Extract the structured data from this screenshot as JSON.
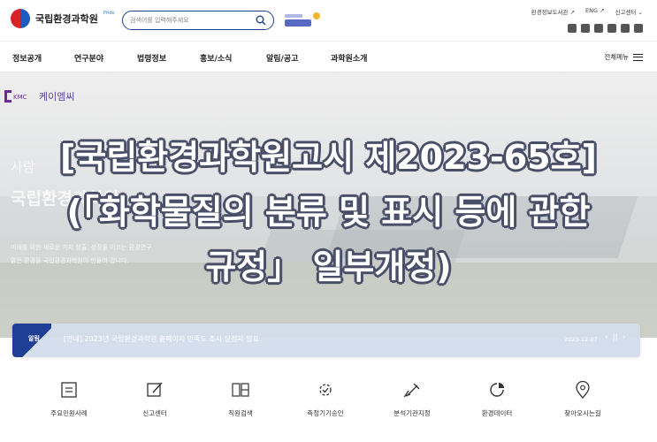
{
  "header": {
    "logo_text": "국립환경과학원",
    "logo_sub": "Pride",
    "search_placeholder": "검색어를 입력해주세요",
    "utility": [
      "환경정보도서관 ↗",
      "ENG ↗",
      "신고센터 ⌄"
    ],
    "social_icons": [
      "facebook-icon",
      "twitter-icon",
      "blog-icon",
      "instagram-icon",
      "kakao-icon",
      "youtube-icon"
    ]
  },
  "nav": {
    "items": [
      "정보공개",
      "연구분야",
      "법령정보",
      "홍보/소식",
      "알림/공고",
      "과학원소개"
    ],
    "all_menu": "전체메뉴"
  },
  "hero": {
    "brand": "케이엠씨",
    "brand_mark": "KMC",
    "subtitle1": "사람",
    "subtitle2": "국립환경과학원",
    "desc1": "미래를 위한 새로운 가치 창출, 성장을 이끄는 환경연구",
    "desc2": "맑은 환경을 국립환경과학원이 만들어 갑니다."
  },
  "overlay": {
    "line1": "[국립환경과학원고시 제2023-65호]",
    "line2": "(「화학물질의 분류 및 표시 등에 관한",
    "line3": "규정」 일부개정)"
  },
  "notice": {
    "label": "알림",
    "text": "[안내] 2023년 국립환경과학원 홈페이지 만족도 조사 당첨자 발표",
    "date": "2023-12-07",
    "controls": [
      "‹",
      "||",
      "›"
    ]
  },
  "quick_menu": [
    {
      "label": "주요민원사례",
      "icon": "document-list-icon"
    },
    {
      "label": "신고센터",
      "icon": "edit-icon"
    },
    {
      "label": "직원검색",
      "icon": "staff-search-icon"
    },
    {
      "label": "측정기기승인",
      "icon": "gear-check-icon"
    },
    {
      "label": "분석기관지정",
      "icon": "flask-icon"
    },
    {
      "label": "환경데이터",
      "icon": "data-chart-icon"
    },
    {
      "label": "찾아오시는길",
      "icon": "map-pin-icon"
    }
  ],
  "colors": {
    "primary": "#1c3f8f",
    "overlay_outline": "#4a4f68",
    "notice_bg": "#d3dceb"
  }
}
